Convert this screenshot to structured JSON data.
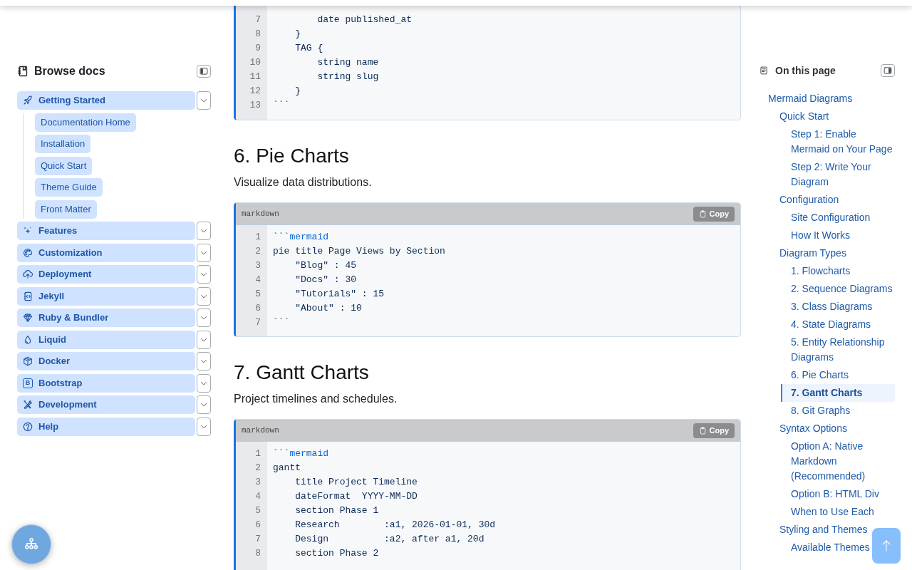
{
  "sidebar": {
    "title": "Browse docs",
    "items": [
      {
        "label": "Getting Started",
        "children": [
          {
            "label": "Documentation Home"
          },
          {
            "label": "Installation"
          },
          {
            "label": "Quick Start"
          },
          {
            "label": "Theme Guide"
          },
          {
            "label": "Front Matter"
          }
        ]
      },
      {
        "label": "Features"
      },
      {
        "label": "Customization"
      },
      {
        "label": "Deployment"
      },
      {
        "label": "Jekyll"
      },
      {
        "label": "Ruby & Bundler"
      },
      {
        "label": "Liquid"
      },
      {
        "label": "Docker"
      },
      {
        "label": "Bootstrap",
        "icon_glyph": "B"
      },
      {
        "label": "Development"
      },
      {
        "label": "Help"
      }
    ]
  },
  "content": [
    {
      "kind": "code",
      "clipped_top": true,
      "lines": [
        {
          "number": "7",
          "text": "        date published_at"
        },
        {
          "number": "8",
          "text": "    }"
        },
        {
          "number": "9",
          "text": "    TAG {"
        },
        {
          "number": "10",
          "text": "        string name"
        },
        {
          "number": "11",
          "text": "        string slug"
        },
        {
          "number": "12",
          "text": "    }"
        },
        {
          "number": "13",
          "text": "```"
        }
      ]
    },
    {
      "kind": "heading",
      "text": "6. Pie Charts"
    },
    {
      "kind": "paragraph",
      "text": "Visualize data distributions."
    },
    {
      "kind": "code",
      "language": "markdown",
      "copy_label": "Copy",
      "lines": [
        {
          "number": "1",
          "text": "```",
          "info": "mermaid"
        },
        {
          "number": "2",
          "text": "pie title Page Views by Section"
        },
        {
          "number": "3",
          "text": "    \"Blog\" : 45"
        },
        {
          "number": "4",
          "text": "    \"Docs\" : 30"
        },
        {
          "number": "5",
          "text": "    \"Tutorials\" : 15"
        },
        {
          "number": "6",
          "text": "    \"About\" : 10"
        },
        {
          "number": "7",
          "text": "```"
        }
      ]
    },
    {
      "kind": "heading",
      "text": "7. Gantt Charts"
    },
    {
      "kind": "paragraph",
      "text": "Project timelines and schedules."
    },
    {
      "kind": "code",
      "language": "markdown",
      "copy_label": "Copy",
      "clipped_bottom": true,
      "lines": [
        {
          "number": "1",
          "text": "```",
          "info": "mermaid"
        },
        {
          "number": "2",
          "text": "gantt"
        },
        {
          "number": "3",
          "text": "    title Project Timeline"
        },
        {
          "number": "4",
          "text": "    dateFormat  YYYY-MM-DD"
        },
        {
          "number": "5",
          "text": "    section Phase 1"
        },
        {
          "number": "6",
          "text": "    Research        :a1, 2026-01-01, 30d"
        },
        {
          "number": "7",
          "text": "    Design          :a2, after a1, 20d"
        },
        {
          "number": "8",
          "text": "    section Phase 2"
        }
      ]
    }
  ],
  "toc": {
    "title": "On this page",
    "items": [
      {
        "label": "Mermaid Diagrams",
        "selected": false,
        "children": [
          {
            "label": "Quick Start",
            "selected": false,
            "children": [
              {
                "label": "Step 1: Enable Mermaid on Your Page",
                "selected": false
              },
              {
                "label": "Step 2: Write Your Diagram",
                "selected": false
              }
            ]
          },
          {
            "label": "Configuration",
            "selected": false,
            "children": [
              {
                "label": "Site Configuration",
                "selected": false
              },
              {
                "label": "How It Works",
                "selected": false
              }
            ]
          },
          {
            "label": "Diagram Types",
            "selected": false,
            "children": [
              {
                "label": "1. Flowcharts",
                "selected": false
              },
              {
                "label": "2. Sequence Diagrams",
                "selected": false
              },
              {
                "label": "3. Class Diagrams",
                "selected": false
              },
              {
                "label": "4. State Diagrams",
                "selected": false
              },
              {
                "label": "5. Entity Relationship Diagrams",
                "selected": false
              },
              {
                "label": "6. Pie Charts",
                "selected": false
              },
              {
                "label": "7. Gantt Charts",
                "selected": true
              },
              {
                "label": "8. Git Graphs",
                "selected": false
              }
            ]
          },
          {
            "label": "Syntax Options",
            "selected": false,
            "children": [
              {
                "label": "Option A: Native Markdown (Recommended)",
                "selected": false
              },
              {
                "label": "Option B: HTML Div",
                "selected": false
              },
              {
                "label": "When to Use Each",
                "selected": false
              }
            ]
          },
          {
            "label": "Styling and Themes",
            "selected": false,
            "children": [
              {
                "label": "Available Themes",
                "selected": false
              }
            ]
          }
        ]
      }
    ]
  }
}
